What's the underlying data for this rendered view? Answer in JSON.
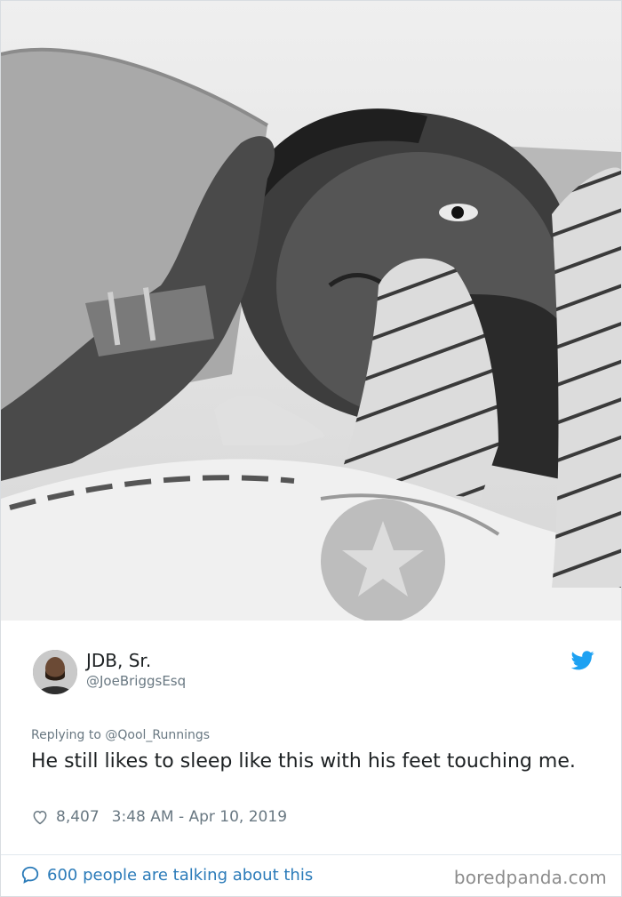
{
  "tweet": {
    "author_name": "JDB, Sr.",
    "author_handle": "@JoeBriggsEsq",
    "replying_to": "Replying to @Qool_Runnings",
    "text": "He still likes to sleep like this with his feet touching me.",
    "likes": "8,407",
    "timestamp": "3:48 AM - Apr 10, 2019"
  },
  "footer": {
    "conversation_label": "600 people are talking about this",
    "watermark": "boredpanda.com"
  },
  "colors": {
    "twitter_blue": "#1da1f2",
    "link_blue": "#2b7bb9",
    "muted_gray": "#697882",
    "text_dark": "#1c2022"
  },
  "icons": {
    "brand": "twitter-bird-icon",
    "like": "heart-icon",
    "conversation": "speech-bubble-icon"
  }
}
